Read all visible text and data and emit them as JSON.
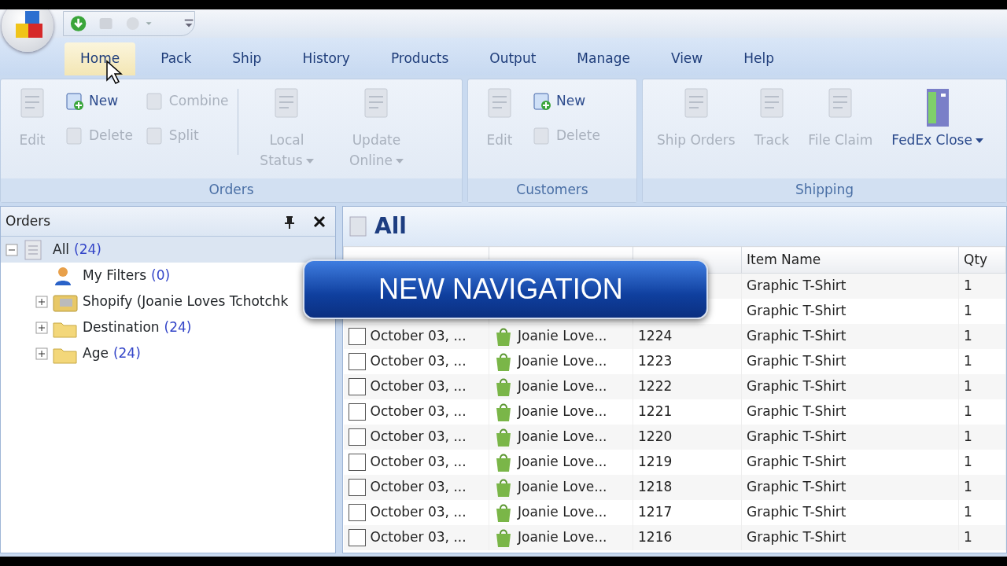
{
  "tabs": [
    {
      "label": "Home",
      "selected": true
    },
    {
      "label": "Pack",
      "selected": false
    },
    {
      "label": "Ship",
      "selected": false
    },
    {
      "label": "History",
      "selected": false
    },
    {
      "label": "Products",
      "selected": false
    },
    {
      "label": "Output",
      "selected": false
    },
    {
      "label": "Manage",
      "selected": false
    },
    {
      "label": "View",
      "selected": false
    },
    {
      "label": "Help",
      "selected": false
    }
  ],
  "ribbon_groups": [
    {
      "label": "Orders",
      "columns": [
        {
          "kind": "large",
          "buttons": [
            {
              "label": "Edit",
              "disabled": true
            }
          ]
        },
        {
          "kind": "stack",
          "buttons": [
            {
              "label": "New",
              "disabled": false
            },
            {
              "label": "Delete",
              "disabled": true
            }
          ]
        },
        {
          "kind": "stack",
          "buttons": [
            {
              "label": "Combine",
              "disabled": true
            },
            {
              "label": "Split",
              "disabled": true
            }
          ]
        },
        {
          "kind": "separator"
        },
        {
          "kind": "large",
          "buttons": [
            {
              "label": "Local Status",
              "disabled": true,
              "dropdown": true
            }
          ]
        },
        {
          "kind": "large",
          "buttons": [
            {
              "label": "Update Online",
              "disabled": true,
              "dropdown": true
            }
          ]
        }
      ]
    },
    {
      "label": "Customers",
      "columns": [
        {
          "kind": "large",
          "buttons": [
            {
              "label": "Edit",
              "disabled": true
            }
          ]
        },
        {
          "kind": "stack",
          "buttons": [
            {
              "label": "New",
              "disabled": false
            },
            {
              "label": "Delete",
              "disabled": true
            }
          ]
        }
      ]
    },
    {
      "label": "Shipping",
      "columns": [
        {
          "kind": "large",
          "buttons": [
            {
              "label": "Ship Orders",
              "disabled": true
            }
          ]
        },
        {
          "kind": "large",
          "buttons": [
            {
              "label": "Track",
              "disabled": true
            }
          ]
        },
        {
          "kind": "large",
          "buttons": [
            {
              "label": "File Claim",
              "disabled": true
            }
          ]
        },
        {
          "kind": "large",
          "buttons": [
            {
              "label": "FedEx Close",
              "disabled": false,
              "dropdown": true
            }
          ]
        }
      ]
    }
  ],
  "side_panel": {
    "title": "Orders",
    "tree": [
      {
        "label": "All",
        "count": "(24)",
        "kind": "list",
        "expanded": true,
        "selected": true,
        "children": [
          {
            "label": "My Filters",
            "count": "(0)",
            "kind": "person",
            "selected": false
          },
          {
            "label": "Shopify (Joanie Loves Tchotchk",
            "kind": "store",
            "expanded": false,
            "selected": false
          },
          {
            "label": "Destination",
            "count": "(24)",
            "kind": "folder",
            "expanded": false,
            "selected": false
          },
          {
            "label": "Age",
            "count": "(24)",
            "kind": "folder",
            "expanded": false,
            "selected": false
          }
        ]
      }
    ]
  },
  "grid": {
    "title": "All",
    "columns": [
      {
        "kind": "covered"
      },
      {
        "kind": "covered"
      },
      {
        "kind": "covered"
      },
      {
        "label": "Item Name"
      },
      {
        "label": "Qty"
      }
    ],
    "rows": [
      {
        "item": "Graphic T-Shirt",
        "qty": "1"
      },
      {
        "item": "Graphic T-Shirt",
        "qty": "1"
      },
      {
        "checked": false,
        "date": "October 03, ...",
        "store": "Joanie Love...",
        "order": "1224",
        "item": "Graphic T-Shirt",
        "qty": "1"
      },
      {
        "checked": false,
        "date": "October 03, ...",
        "store": "Joanie Love...",
        "order": "1223",
        "item": "Graphic T-Shirt",
        "qty": "1"
      },
      {
        "checked": false,
        "date": "October 03, ...",
        "store": "Joanie Love...",
        "order": "1222",
        "item": "Graphic T-Shirt",
        "qty": "1"
      },
      {
        "checked": false,
        "date": "October 03, ...",
        "store": "Joanie Love...",
        "order": "1221",
        "item": "Graphic T-Shirt",
        "qty": "1"
      },
      {
        "checked": false,
        "date": "October 03, ...",
        "store": "Joanie Love...",
        "order": "1220",
        "item": "Graphic T-Shirt",
        "qty": "1"
      },
      {
        "checked": false,
        "date": "October 03, ...",
        "store": "Joanie Love...",
        "order": "1219",
        "item": "Graphic T-Shirt",
        "qty": "1"
      },
      {
        "checked": false,
        "date": "October 03, ...",
        "store": "Joanie Love...",
        "order": "1218",
        "item": "Graphic T-Shirt",
        "qty": "1"
      },
      {
        "checked": false,
        "date": "October 03, ...",
        "store": "Joanie Love...",
        "order": "1217",
        "item": "Graphic T-Shirt",
        "qty": "1"
      },
      {
        "checked": false,
        "date": "October 03, ...",
        "store": "Joanie Love...",
        "order": "1216",
        "item": "Graphic T-Shirt",
        "qty": "1"
      }
    ]
  },
  "banner": {
    "text": "NEW NAVIGATION"
  }
}
